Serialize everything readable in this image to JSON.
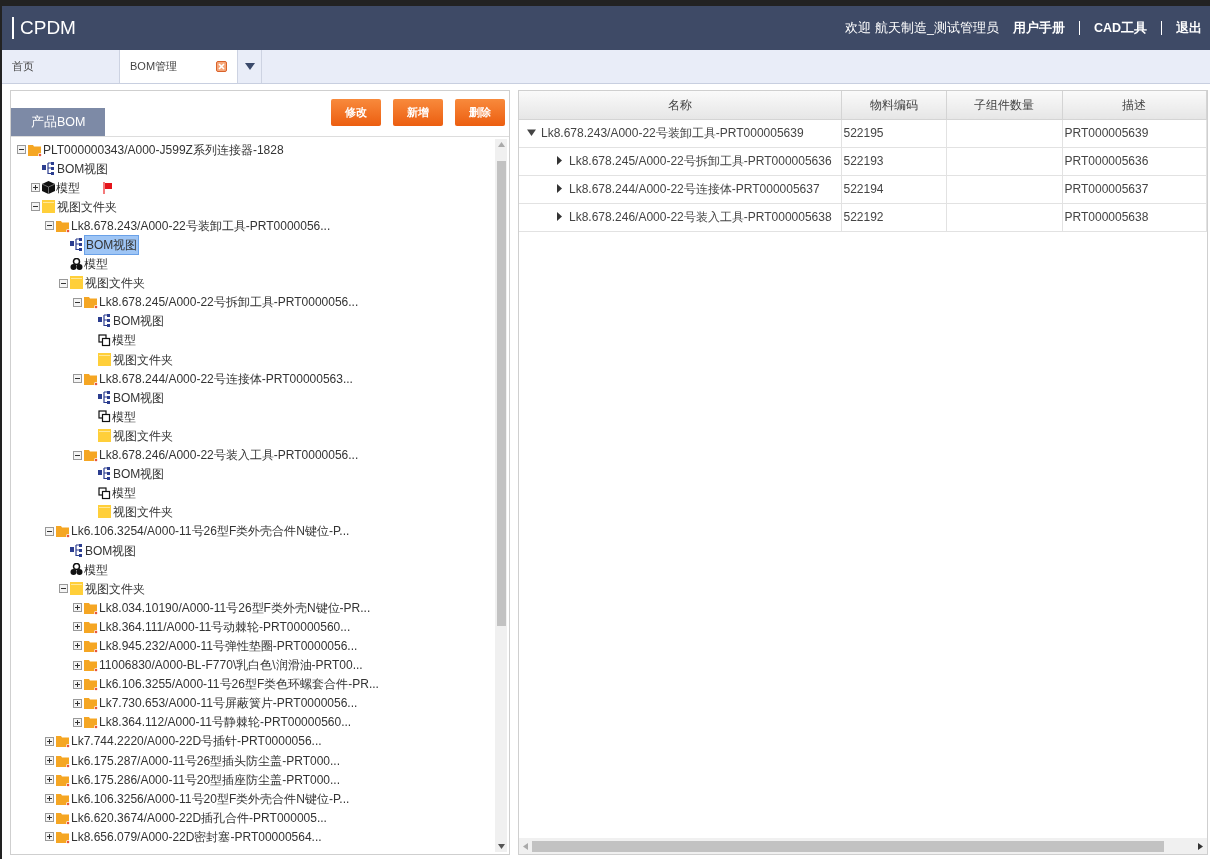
{
  "header": {
    "logo": "CPDM",
    "welcome": "欢迎 航天制造_测试管理员",
    "links": [
      "用户手册",
      "CAD工具",
      "退出"
    ]
  },
  "tabs": [
    {
      "label": "首页",
      "selected": false,
      "closable": false
    },
    {
      "label": "BOM管理",
      "selected": true,
      "closable": true
    }
  ],
  "left_panel": {
    "tab": "产品BOM",
    "buttons": [
      "修改",
      "新增",
      "删除"
    ],
    "tree": [
      {
        "label": "PLT000000343/A000-J599Z系列连接器-1828",
        "kind": "folder",
        "expanded": true,
        "selected": false,
        "flagged": false,
        "children": [
          {
            "label": "BOM视图",
            "kind": "bom",
            "selected": false,
            "flagged": false
          },
          {
            "label": "模型",
            "kind": "cube",
            "expanded": false,
            "selected": false,
            "flagged": true
          },
          {
            "label": "视图文件夹",
            "kind": "viewfolder",
            "expanded": true,
            "selected": false,
            "flagged": false,
            "children": [
              {
                "label": "Lk8.678.243/A000-22号装卸工具-PRT0000056...",
                "kind": "folder",
                "expanded": true,
                "selected": false,
                "flagged": false,
                "children": [
                  {
                    "label": "BOM视图",
                    "kind": "bom",
                    "selected": true,
                    "flagged": false
                  },
                  {
                    "label": "模型",
                    "kind": "cluster",
                    "selected": false,
                    "flagged": false
                  },
                  {
                    "label": "视图文件夹",
                    "kind": "viewfolder",
                    "expanded": true,
                    "selected": false,
                    "flagged": false,
                    "children": [
                      {
                        "label": "Lk8.678.245/A000-22号拆卸工具-PRT0000056...",
                        "kind": "folder",
                        "expanded": true,
                        "selected": false,
                        "flagged": false,
                        "children": [
                          {
                            "label": "BOM视图",
                            "kind": "bom",
                            "selected": false,
                            "flagged": false
                          },
                          {
                            "label": "模型",
                            "kind": "copy",
                            "selected": false,
                            "flagged": false
                          },
                          {
                            "label": "视图文件夹",
                            "kind": "viewfolder",
                            "selected": false,
                            "flagged": false
                          }
                        ]
                      },
                      {
                        "label": "Lk8.678.244/A000-22号连接体-PRT00000563...",
                        "kind": "folder",
                        "expanded": true,
                        "selected": false,
                        "flagged": false,
                        "children": [
                          {
                            "label": "BOM视图",
                            "kind": "bom",
                            "selected": false,
                            "flagged": false
                          },
                          {
                            "label": "模型",
                            "kind": "copy",
                            "selected": false,
                            "flagged": false
                          },
                          {
                            "label": "视图文件夹",
                            "kind": "viewfolder",
                            "selected": false,
                            "flagged": false
                          }
                        ]
                      },
                      {
                        "label": "Lk8.678.246/A000-22号装入工具-PRT0000056...",
                        "kind": "folder",
                        "expanded": true,
                        "selected": false,
                        "flagged": false,
                        "children": [
                          {
                            "label": "BOM视图",
                            "kind": "bom",
                            "selected": false,
                            "flagged": false
                          },
                          {
                            "label": "模型",
                            "kind": "copy",
                            "selected": false,
                            "flagged": false
                          },
                          {
                            "label": "视图文件夹",
                            "kind": "viewfolder",
                            "selected": false,
                            "flagged": false
                          }
                        ]
                      }
                    ]
                  }
                ]
              },
              {
                "label": "Lk6.106.3254/A000-11号26型F类外壳合件N键位-P...",
                "kind": "folder",
                "expanded": true,
                "selected": false,
                "flagged": false,
                "children": [
                  {
                    "label": "BOM视图",
                    "kind": "bom",
                    "selected": false,
                    "flagged": false
                  },
                  {
                    "label": "模型",
                    "kind": "cluster",
                    "selected": false,
                    "flagged": false
                  },
                  {
                    "label": "视图文件夹",
                    "kind": "viewfolder",
                    "expanded": true,
                    "selected": false,
                    "flagged": false,
                    "children": [
                      {
                        "label": "Lk8.034.10190/A000-11号26型F类外壳N键位-PR...",
                        "kind": "folder",
                        "expanded": false,
                        "selected": false,
                        "flagged": false
                      },
                      {
                        "label": "Lk8.364.111/A000-11号动棘轮-PRT00000560...",
                        "kind": "folder",
                        "expanded": false,
                        "selected": false,
                        "flagged": false
                      },
                      {
                        "label": "Lk8.945.232/A000-11号弹性垫圈-PRT0000056...",
                        "kind": "folder",
                        "expanded": false,
                        "selected": false,
                        "flagged": false
                      },
                      {
                        "label": "11006830/A000-BL-F770\\乳白色\\润滑油-PRT00...",
                        "kind": "folder",
                        "expanded": false,
                        "selected": false,
                        "flagged": false
                      },
                      {
                        "label": "Lk6.106.3255/A000-11号26型F类色环螺套合件-PR...",
                        "kind": "folder",
                        "expanded": false,
                        "selected": false,
                        "flagged": false
                      },
                      {
                        "label": "Lk7.730.653/A000-11号屏蔽簧片-PRT0000056...",
                        "kind": "folder",
                        "expanded": false,
                        "selected": false,
                        "flagged": false
                      },
                      {
                        "label": "Lk8.364.112/A000-11号静棘轮-PRT00000560...",
                        "kind": "folder",
                        "expanded": false,
                        "selected": false,
                        "flagged": false
                      }
                    ]
                  }
                ]
              },
              {
                "label": "Lk7.744.2220/A000-22D号插针-PRT0000056...",
                "kind": "folder",
                "expanded": false,
                "selected": false,
                "flagged": false
              },
              {
                "label": "Lk6.175.287/A000-11号26型插头防尘盖-PRT000...",
                "kind": "folder",
                "expanded": false,
                "selected": false,
                "flagged": false
              },
              {
                "label": "Lk6.175.286/A000-11号20型插座防尘盖-PRT000...",
                "kind": "folder",
                "expanded": false,
                "selected": false,
                "flagged": false
              },
              {
                "label": "Lk6.106.3256/A000-11号20型F类外壳合件N键位-P...",
                "kind": "folder",
                "expanded": false,
                "selected": false,
                "flagged": false
              },
              {
                "label": "Lk6.620.3674/A000-22D插孔合件-PRT000005...",
                "kind": "folder",
                "expanded": false,
                "selected": false,
                "flagged": false
              },
              {
                "label": "Lk8.656.079/A000-22D密封塞-PRT00000564...",
                "kind": "folder",
                "expanded": false,
                "selected": false,
                "flagged": false
              }
            ]
          }
        ]
      }
    ]
  },
  "table": {
    "columns": [
      "名称",
      "物料编码",
      "子组件数量",
      "描述"
    ],
    "rows": [
      {
        "name": "Lk8.678.243/A000-22号装卸工具-PRT000005639",
        "code": "522195",
        "description": "PRT000005639",
        "expanded": true,
        "children": [
          {
            "name": "Lk8.678.245/A000-22号拆卸工具-PRT000005636",
            "code": "522193",
            "description": "PRT000005636",
            "expanded": false
          },
          {
            "name": "Lk8.678.244/A000-22号连接体-PRT000005637",
            "code": "522194",
            "description": "PRT000005637",
            "expanded": false
          },
          {
            "name": "Lk8.678.246/A000-22号装入工具-PRT000005638",
            "code": "522192",
            "description": "PRT000005638",
            "expanded": false
          }
        ]
      }
    ]
  }
}
